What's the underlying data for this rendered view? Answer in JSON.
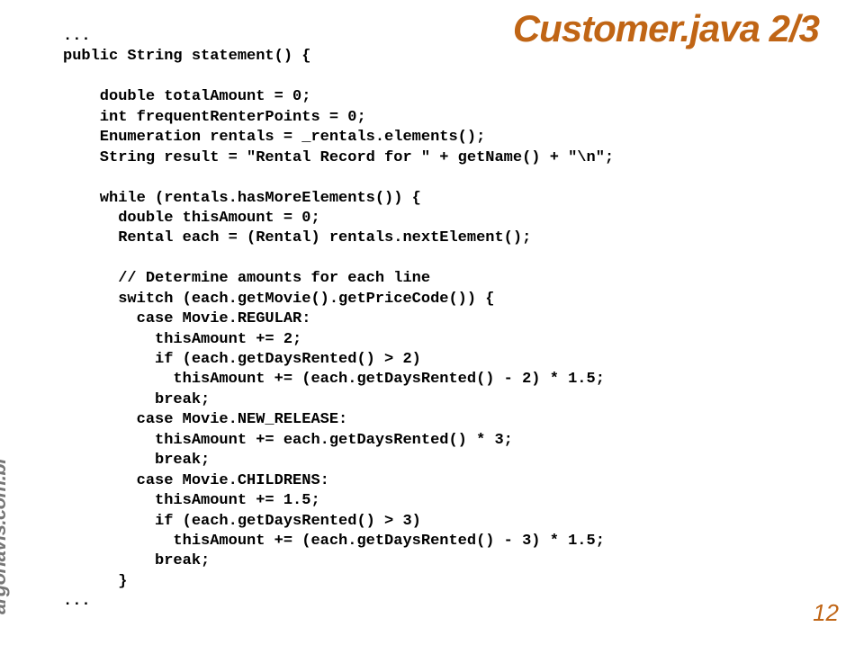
{
  "title": "Customer.java 2/3",
  "brand": "argonavis.com.br",
  "page_number": "12",
  "code": "...\npublic String statement() {\n\n    double totalAmount = 0;\n    int frequentRenterPoints = 0;\n    Enumeration rentals = _rentals.elements();\n    String result = \"Rental Record for \" + getName() + \"\\n\";\n\n    while (rentals.hasMoreElements()) {\n      double thisAmount = 0;\n      Rental each = (Rental) rentals.nextElement();\n\n      // Determine amounts for each line\n      switch (each.getMovie().getPriceCode()) {\n        case Movie.REGULAR:\n          thisAmount += 2;\n          if (each.getDaysRented() > 2)\n            thisAmount += (each.getDaysRented() - 2) * 1.5;\n          break;\n        case Movie.NEW_RELEASE:\n          thisAmount += each.getDaysRented() * 3;\n          break;\n        case Movie.CHILDRENS:\n          thisAmount += 1.5;\n          if (each.getDaysRented() > 3)\n            thisAmount += (each.getDaysRented() - 3) * 1.5;\n          break;\n      }\n..."
}
